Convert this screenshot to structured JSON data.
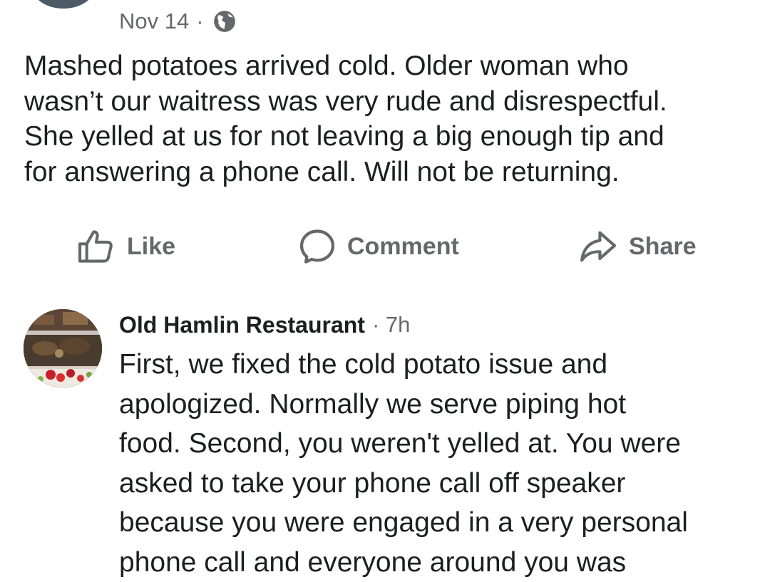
{
  "post": {
    "date": "Nov 14",
    "separator": "·",
    "privacy_icon": "globe-icon",
    "text": "Mashed potatoes arrived cold. Older woman who\nwasn’t our waitress was very rude and disrespectful.\nShe yelled at us for not leaving a big enough tip and\nfor answering a phone call. Will not be returning."
  },
  "actions": {
    "like_label": "Like",
    "like_icon": "thumbs-up-icon",
    "comment_label": "Comment",
    "comment_icon": "speech-bubble-icon",
    "share_label": "Share",
    "share_icon": "share-arrow-icon"
  },
  "comment": {
    "author": "Old Hamlin Restaurant",
    "time": "· 7h",
    "text": "First, we fixed the cold potato issue and\napologized. Normally we serve piping hot\nfood. Second, you weren't yelled at. You were\nasked to take your phone call off speaker\nbecause you were engaged in a very personal\nphone call and everyone around you was"
  },
  "colors": {
    "text_primary": "#1c1e21",
    "text_secondary": "#65676b",
    "background": "#ffffff"
  }
}
